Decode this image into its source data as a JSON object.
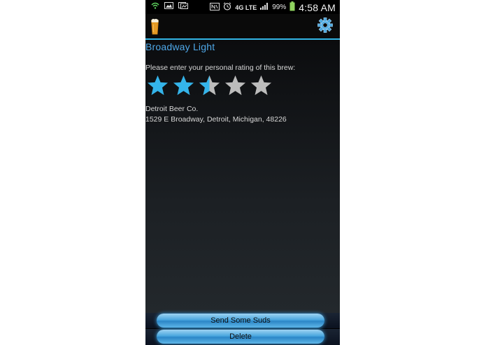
{
  "status_bar": {
    "battery_percent": "99%",
    "network": "4G LTE",
    "time": "4:58 AM"
  },
  "action_bar": {
    "app_icon": "beer-glass-icon",
    "settings_icon": "gear-icon",
    "accent_color": "#33b5e5"
  },
  "brew": {
    "name": "Broadway Light",
    "rating_prompt": "Please enter your personal rating of this brew:",
    "rating": 2.5,
    "max_rating": 5,
    "brewery": "Detroit Beer Co.",
    "address": "1529 E Broadway, Detroit, Michigan, 48226"
  },
  "buttons": {
    "send_label": "Send Some Suds",
    "delete_label": "Delete"
  }
}
